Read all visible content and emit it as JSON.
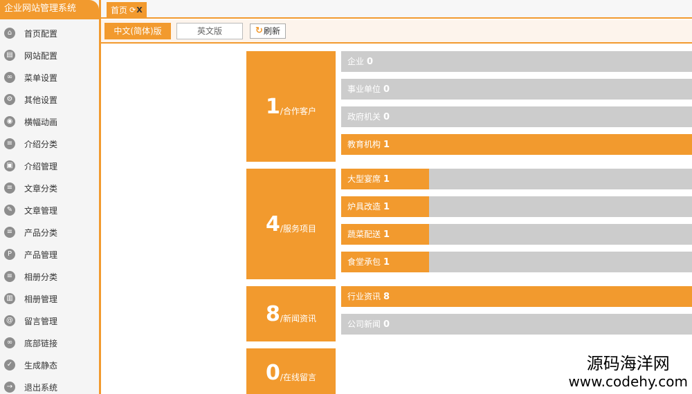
{
  "sidebar": {
    "title": "企业网站管理系统",
    "items": [
      {
        "label": "首页配置",
        "icon": "home-icon",
        "glyph": "⌂"
      },
      {
        "label": "网站配置",
        "icon": "document-icon",
        "glyph": "▤"
      },
      {
        "label": "菜单设置",
        "icon": "link-icon",
        "glyph": "∞"
      },
      {
        "label": "其他设置",
        "icon": "gear-icon",
        "glyph": "⚙"
      },
      {
        "label": "横幅动画",
        "icon": "camera-icon",
        "glyph": "◉"
      },
      {
        "label": "介绍分类",
        "icon": "list-icon",
        "glyph": "≡"
      },
      {
        "label": "介绍管理",
        "icon": "pages-icon",
        "glyph": "▣"
      },
      {
        "label": "文章分类",
        "icon": "list-icon",
        "glyph": "≡"
      },
      {
        "label": "文章管理",
        "icon": "edit-icon",
        "glyph": "✎"
      },
      {
        "label": "产品分类",
        "icon": "list-icon",
        "glyph": "≡"
      },
      {
        "label": "产品管理",
        "icon": "product-icon",
        "glyph": "P"
      },
      {
        "label": "相册分类",
        "icon": "list-icon",
        "glyph": "≡"
      },
      {
        "label": "相册管理",
        "icon": "album-icon",
        "glyph": "▥"
      },
      {
        "label": "留言管理",
        "icon": "at-icon",
        "glyph": "@"
      },
      {
        "label": "底部链接",
        "icon": "link-icon",
        "glyph": "∞"
      },
      {
        "label": "生成静态",
        "icon": "check-icon",
        "glyph": "✓"
      },
      {
        "label": "退出系统",
        "icon": "arrow-right-icon",
        "glyph": "→"
      }
    ]
  },
  "tabs": [
    {
      "label": "首页",
      "refresh_glyph": "⟳",
      "close_glyph": "X"
    }
  ],
  "toolbar": {
    "lang_cn": "中文(简体)版",
    "lang_en": "英文版",
    "refresh_glyph": "↻",
    "refresh_label": "刷新"
  },
  "colors": {
    "accent": "#f29a2e",
    "inactive_bar": "#cccccc"
  },
  "groups": [
    {
      "count": "1",
      "label": "/合作客户",
      "rows": [
        {
          "label": "企业",
          "count": "0",
          "fill": 0
        },
        {
          "label": "事业单位",
          "count": "0",
          "fill": 0
        },
        {
          "label": "政府机关",
          "count": "0",
          "fill": 0
        },
        {
          "label": "教育机构",
          "count": "1",
          "fill": 1
        }
      ]
    },
    {
      "count": "4",
      "label": "/服务项目",
      "rows": [
        {
          "label": "大型宴席",
          "count": "1",
          "fill": 0.25
        },
        {
          "label": "炉具改造",
          "count": "1",
          "fill": 0.25
        },
        {
          "label": "蔬菜配送",
          "count": "1",
          "fill": 0.25
        },
        {
          "label": "食堂承包",
          "count": "1",
          "fill": 0.25
        }
      ]
    },
    {
      "count": "8",
      "label": "/新闻资讯",
      "rows": [
        {
          "label": "行业资讯",
          "count": "8",
          "fill": 1
        },
        {
          "label": "公司新闻",
          "count": "0",
          "fill": 0
        }
      ]
    },
    {
      "count": "0",
      "label": "/在线留言",
      "rows": []
    }
  ],
  "watermark": {
    "name": "源码海洋网",
    "url": "www.codehy.com"
  }
}
